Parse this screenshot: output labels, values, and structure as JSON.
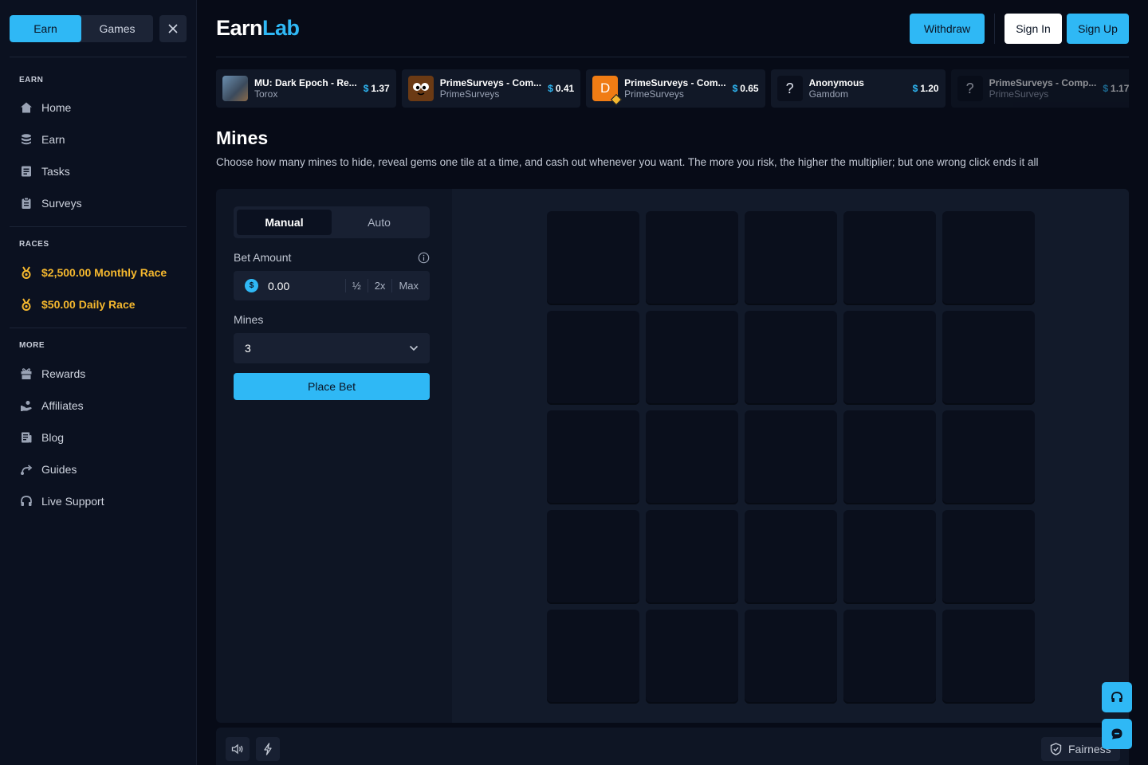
{
  "sidebar": {
    "toggle": {
      "earn_label": "Earn",
      "games_label": "Games"
    },
    "sections": {
      "earn": "EARN",
      "races": "RACES",
      "more": "MORE"
    },
    "earn_items": [
      {
        "label": "Home",
        "icon": "home-icon"
      },
      {
        "label": "Earn",
        "icon": "coins-icon"
      },
      {
        "label": "Tasks",
        "icon": "tasks-icon"
      },
      {
        "label": "Surveys",
        "icon": "clipboard-icon"
      }
    ],
    "race_items": [
      {
        "label": "$2,500.00 Monthly Race",
        "icon": "medal-icon"
      },
      {
        "label": "$50.00 Daily Race",
        "icon": "medal-icon"
      }
    ],
    "more_items": [
      {
        "label": "Rewards",
        "icon": "gift-icon"
      },
      {
        "label": "Affiliates",
        "icon": "affiliates-icon"
      },
      {
        "label": "Blog",
        "icon": "blog-icon"
      },
      {
        "label": "Guides",
        "icon": "guides-icon"
      },
      {
        "label": "Live Support",
        "icon": "headset-icon"
      }
    ]
  },
  "header": {
    "logo_part1": "Earn",
    "logo_part2": "Lab",
    "withdraw_label": "Withdraw",
    "signin_label": "Sign In",
    "signup_label": "Sign Up"
  },
  "feed": [
    {
      "name": "MU: Dark Epoch - Re...",
      "sub": "Torox",
      "currency": "$",
      "amount": "1.37"
    },
    {
      "name": "PrimeSurveys - Com...",
      "sub": "PrimeSurveys",
      "currency": "$",
      "amount": "0.41"
    },
    {
      "name": "PrimeSurveys - Com...",
      "sub": "PrimeSurveys",
      "currency": "$",
      "amount": "0.65",
      "avatar_letter": "D"
    },
    {
      "name": "Anonymous",
      "sub": "Gamdom",
      "currency": "$",
      "amount": "1.20",
      "avatar_letter": "?"
    },
    {
      "name": "PrimeSurveys - Comp...",
      "sub": "PrimeSurveys",
      "currency": "$",
      "amount": "1.17",
      "avatar_letter": "?"
    }
  ],
  "page": {
    "title": "Mines",
    "description": "Choose how many mines to hide, reveal gems one tile at a time, and cash out whenever you want. The more you risk, the higher the multiplier; but one wrong click ends it all"
  },
  "game": {
    "mode_manual": "Manual",
    "mode_auto": "Auto",
    "bet_label": "Bet Amount",
    "bet_value": "0.00",
    "half_label": "½",
    "double_label": "2x",
    "max_label": "Max",
    "mines_label": "Mines",
    "mines_value": "3",
    "place_bet_label": "Place Bet",
    "grid_rows": 5,
    "grid_cols": 5
  },
  "bottom_bar": {
    "fairness_label": "Fairness"
  },
  "colors": {
    "accent": "#2fb8f5",
    "race_gold": "#f5b82e",
    "background": "#070b17",
    "panel": "#0e1524",
    "tile": "#0a0f1c"
  }
}
